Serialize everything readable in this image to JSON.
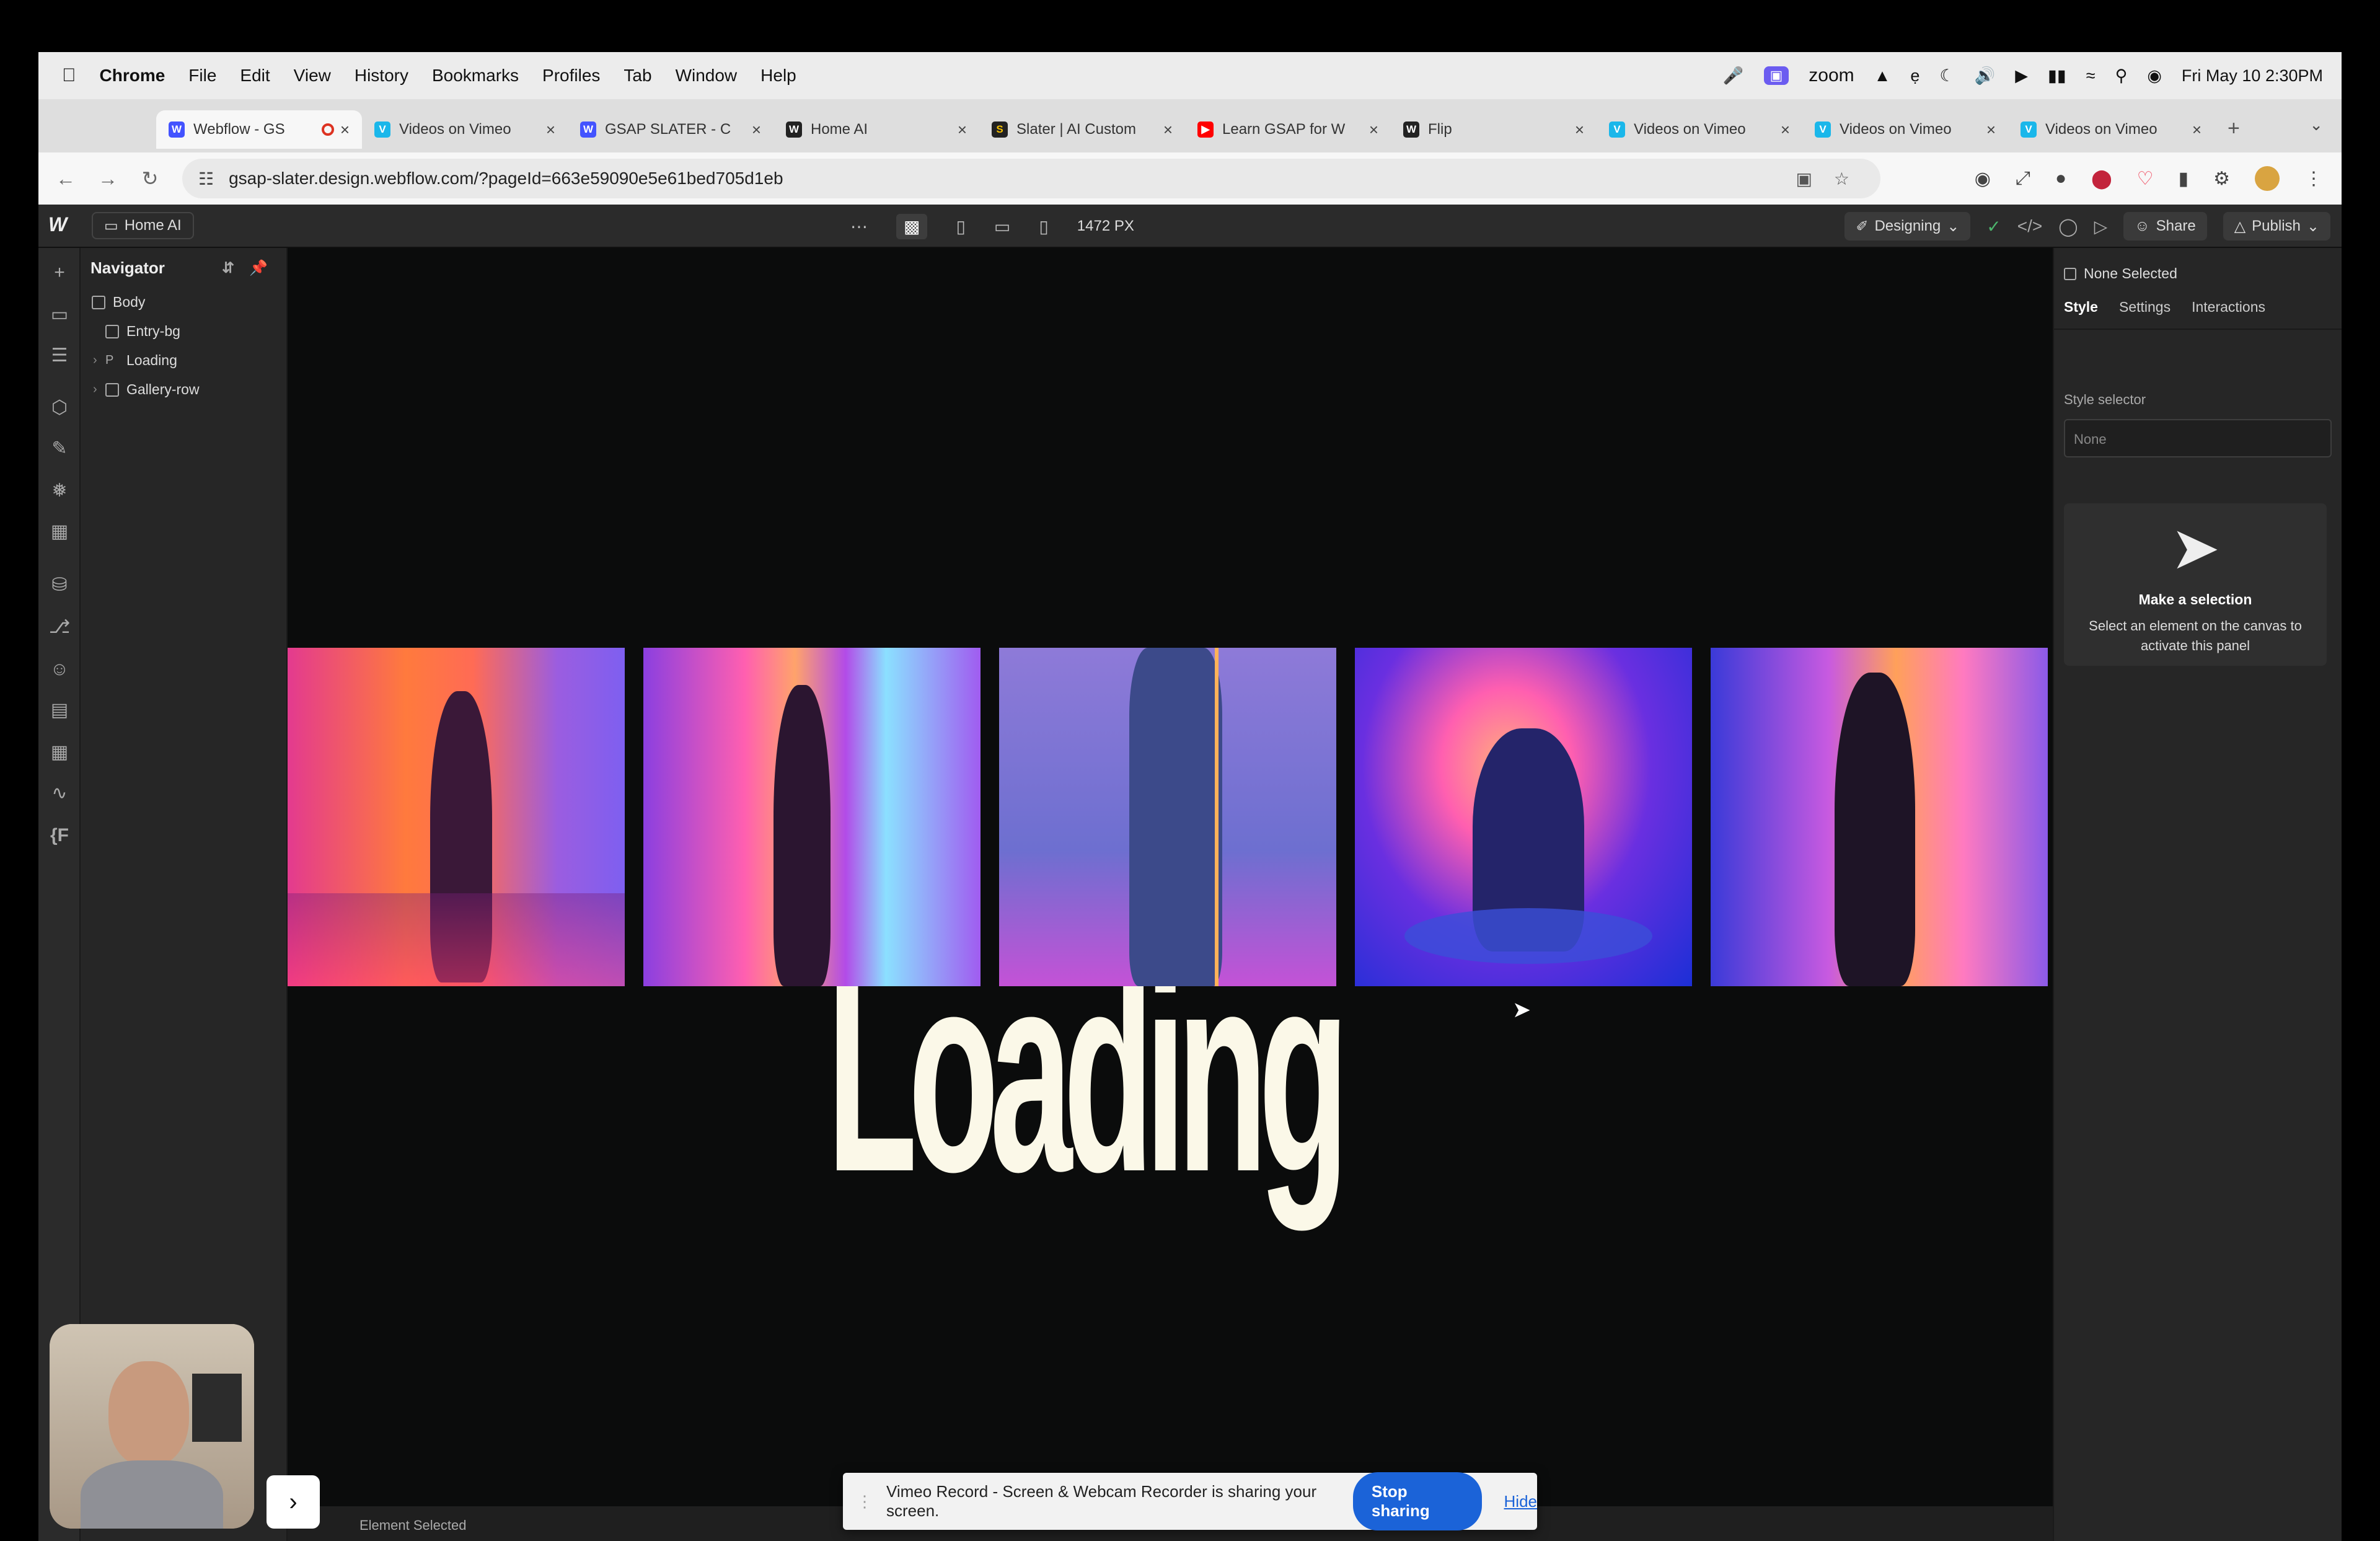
{
  "menubar": {
    "app": "Chrome",
    "items": [
      "File",
      "Edit",
      "View",
      "History",
      "Bookmarks",
      "Profiles",
      "Tab",
      "Window",
      "Help"
    ],
    "right": {
      "zoom": "zoom",
      "datetime": "Fri May 10  2:30PM"
    }
  },
  "tabs": [
    {
      "label": "Webflow - GS",
      "fav": "W",
      "color": "#4353ff",
      "active": true
    },
    {
      "label": "Videos on Vimeo",
      "fav": "V",
      "color": "#1ab7ea"
    },
    {
      "label": "GSAP SLATER - C",
      "fav": "W",
      "color": "#4353ff"
    },
    {
      "label": "Home AI",
      "fav": "W",
      "color": "#222222"
    },
    {
      "label": "Slater | AI Custom",
      "fav": "S",
      "color": "#222222"
    },
    {
      "label": "Learn GSAP for W",
      "fav": "▶",
      "color": "#ff0000"
    },
    {
      "label": "Flip",
      "fav": "W",
      "color": "#222222"
    },
    {
      "label": "Videos on Vimeo",
      "fav": "V",
      "color": "#1ab7ea"
    },
    {
      "label": "Videos on Vimeo",
      "fav": "V",
      "color": "#1ab7ea"
    },
    {
      "label": "Videos on Vimeo",
      "fav": "V",
      "color": "#1ab7ea"
    }
  ],
  "address": {
    "url": "gsap-slater.design.webflow.com/?pageId=663e59090e5e61bed705d1eb"
  },
  "webflow": {
    "page": "Home AI",
    "breakpoint_width": "1472 PX",
    "mode": "Designing",
    "share": "Share",
    "publish": "Publish"
  },
  "navigator": {
    "title": "Navigator",
    "items": [
      {
        "label": "Body",
        "level": 0,
        "kind": "box"
      },
      {
        "label": "Entry-bg",
        "level": 1,
        "kind": "box"
      },
      {
        "label": "Loading",
        "level": 1,
        "kind": "p",
        "collapsed": true
      },
      {
        "label": "Gallery-row",
        "level": 1,
        "kind": "box",
        "collapsed": true
      }
    ]
  },
  "canvas": {
    "word": "Loading"
  },
  "right_panel": {
    "none_selected": "None Selected",
    "tabs": [
      "Style",
      "Settings",
      "Interactions"
    ],
    "style_selector_label": "Style selector",
    "style_selector_placeholder": "None",
    "card_title": "Make a selection",
    "card_line1": "Select an element on the canvas to",
    "card_line2": "activate this panel"
  },
  "status": {
    "text": "Element Selected"
  },
  "share_bar": {
    "message": "Vimeo Record - Screen & Webcam Recorder is sharing your screen.",
    "stop": "Stop sharing",
    "hide": "Hide"
  }
}
